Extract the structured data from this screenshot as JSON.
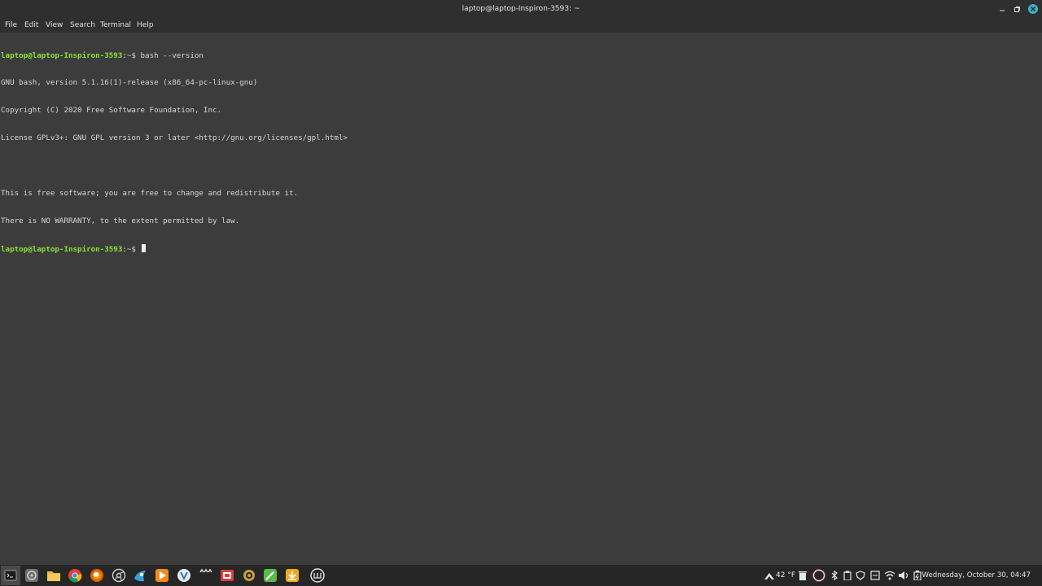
{
  "window": {
    "title": "laptop@laptop-Inspiron-3593: ~"
  },
  "menu": {
    "items": [
      "File",
      "Edit",
      "View",
      "Search",
      "Terminal",
      "Help"
    ]
  },
  "terminal": {
    "prompt": "laptop@laptop-Inspiron-3593",
    "prompt_suffix": ":~$ ",
    "command": "bash --version",
    "output": [
      "GNU bash, version 5.1.16(1)-release (x86_64-pc-linux-gnu)",
      "Copyright (C) 2020 Free Software Foundation, Inc.",
      "License GPLv3+: GNU GPL version 3 or later <http://gnu.org/licenses/gpl.html>",
      "",
      "This is free software; you are free to change and redistribute it.",
      "There is NO WARRANTY, to the extent permitted by law."
    ]
  },
  "taskbar": {
    "weather": "42 °F",
    "clock": "Wednesday, October 30, 04:47",
    "colors": {
      "accent_green": "#8ae234",
      "titlebar": "#2f2f2f",
      "terminal_bg": "#3c3c3c",
      "taskbar_bg": "#262626"
    }
  }
}
